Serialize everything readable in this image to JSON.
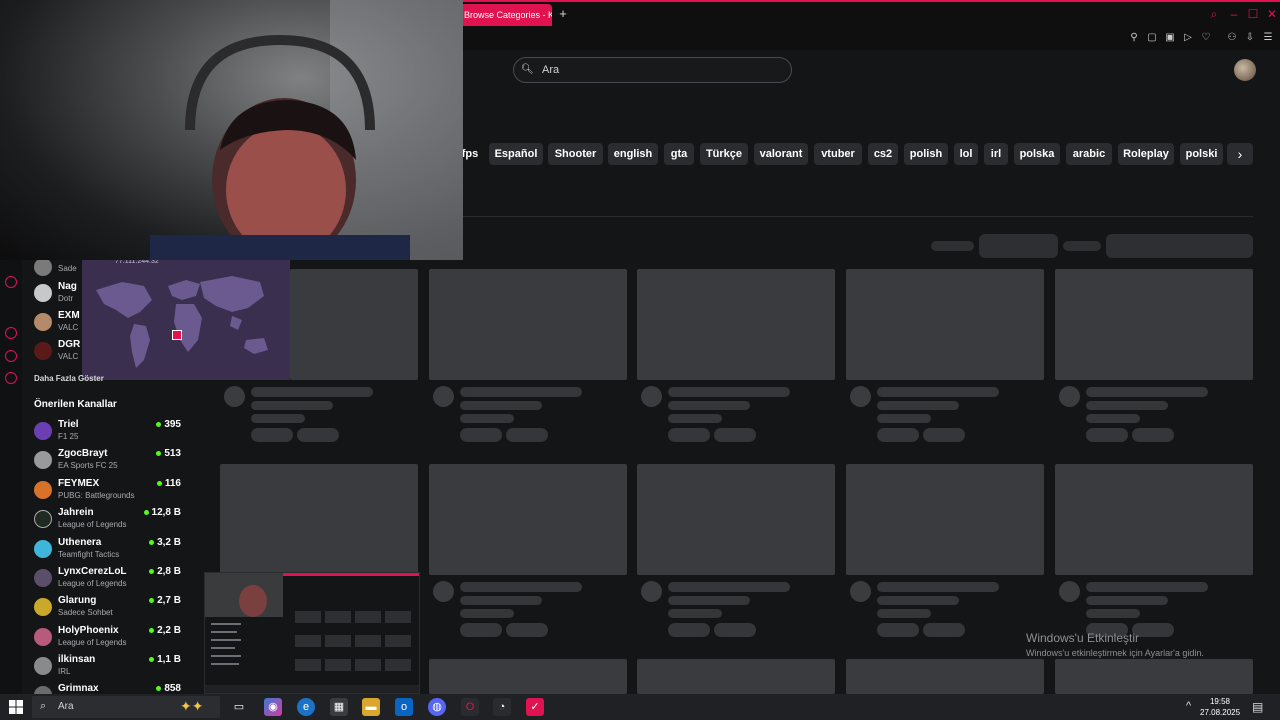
{
  "browser": {
    "tab_title": "Browse Categories - Kick",
    "new_tab": "+"
  },
  "header": {
    "search_placeholder": "Ara"
  },
  "tags": [
    "fps",
    "Español",
    "Shooter",
    "english",
    "gta",
    "Türkçe",
    "valorant",
    "vtuber",
    "cs2",
    "polish",
    "lol",
    "irl",
    "polska",
    "arabic",
    "Roleplay",
    "polski"
  ],
  "followed": [
    {
      "name": "",
      "category": "Sade"
    },
    {
      "name": "Nag",
      "category": "Dotr"
    },
    {
      "name": "EXM",
      "category": "VALC"
    },
    {
      "name": "DGR",
      "category": "VALC"
    }
  ],
  "map_overlay": {
    "ip_text": "77.111.244.32"
  },
  "sidebar": {
    "show_more": "Daha Fazla Göster",
    "recommended_title": "Önerilen Kanallar",
    "channels": [
      {
        "name": "Triel",
        "category": "F1 25",
        "viewers": "395",
        "color": "#6b3fb3"
      },
      {
        "name": "ZgocBrayt",
        "category": "EA Sports FC 25",
        "viewers": "513",
        "color": "#9a9a9a"
      },
      {
        "name": "FEYMEX",
        "category": "PUBG: Battlegrounds",
        "viewers": "116",
        "color": "#d7722a"
      },
      {
        "name": "Jahrein",
        "category": "League of Legends",
        "viewers": "12,8 B",
        "color": "#1f2a22"
      },
      {
        "name": "Uthenera",
        "category": "Teamfight Tactics",
        "viewers": "3,2 B",
        "color": "#3fb6d9"
      },
      {
        "name": "LynxCerezLoL",
        "category": "League of Legends",
        "viewers": "2,8 B",
        "color": "#5a4e6b"
      },
      {
        "name": "Glarung",
        "category": "Sadece Sohbet",
        "viewers": "2,7 B",
        "color": "#c9a82a"
      },
      {
        "name": "HolyPhoenix",
        "category": "League of Legends",
        "viewers": "2,2 B",
        "color": "#b85a7a"
      },
      {
        "name": "ilkinsan",
        "category": "IRL",
        "viewers": "1,1 B",
        "color": "#8a8a8a"
      },
      {
        "name": "Grimnax",
        "category": "",
        "viewers": "858",
        "color": "#6b6b6b"
      }
    ]
  },
  "watermark": {
    "title": "Windows'u Etkinleştir",
    "subtitle": "Windows'u etkinleştirmek için Ayarlar'a gidin."
  },
  "taskbar": {
    "search_placeholder": "Ara",
    "time": "19:58",
    "date": "27.08.2025"
  },
  "colors": {
    "accent": "#e0124f",
    "live": "#53fc18"
  }
}
